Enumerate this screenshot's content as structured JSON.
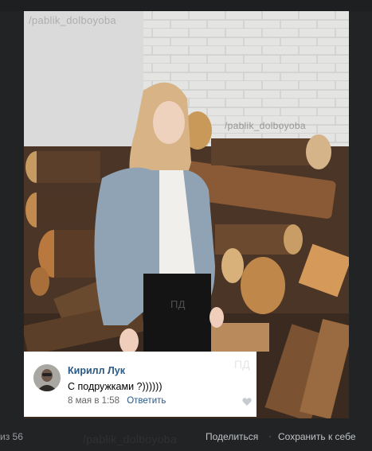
{
  "photo": {
    "watermark_top": "/pablik_dolboyoba",
    "watermark_mid": "/pablik_dolboyoba",
    "watermark_pd": "ПД"
  },
  "comment": {
    "author": "Кирилл Лук",
    "text": "С подружками ?))))))",
    "date": "8 мая в 1:58",
    "reply_label": "Ответить",
    "watermark_pd": "ПД"
  },
  "bottom_bar": {
    "counter": "из 56",
    "watermark": "/pablik_dolboyoba",
    "share_label": "Поделиться",
    "separator": "·",
    "save_label": "Сохранить к себе"
  },
  "colors": {
    "link": "#2a5885",
    "background": "#222324"
  }
}
